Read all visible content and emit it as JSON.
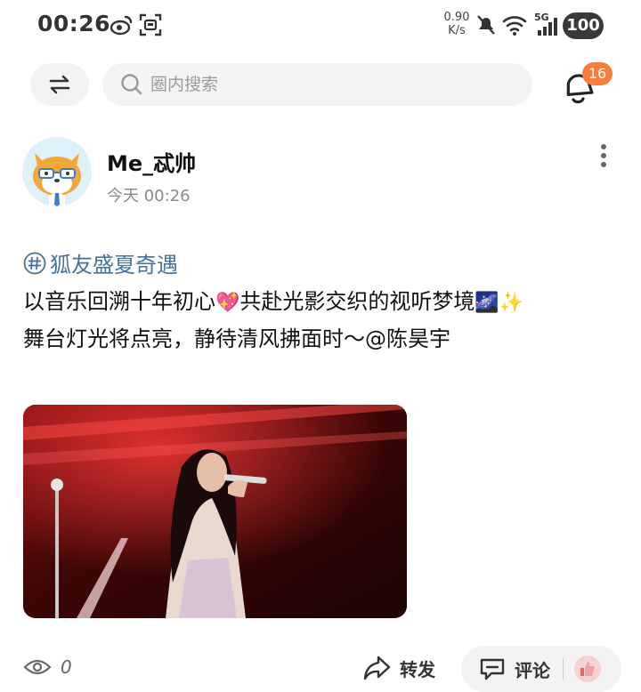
{
  "status_bar": {
    "time": "00:26",
    "net_speed_value": "0.90",
    "net_speed_unit": "K/s",
    "signal_label": "5G",
    "battery": "100",
    "icons": [
      "weibo-icon",
      "screenshot-icon",
      "mute-icon",
      "wifi-icon",
      "signal-icon"
    ]
  },
  "top_bar": {
    "search_placeholder": "圈内搜索",
    "notification_count": "16"
  },
  "post": {
    "author": "Me_忒帅",
    "time": "今天 00:26",
    "topic": "狐友盛夏奇遇",
    "line1_a": "以音乐回溯十年初心",
    "emoji_heart": "💖",
    "line1_b": "共赴光影交织的视听梦境",
    "emoji_galaxy": "🌌",
    "emoji_sparkles": "✨",
    "line2": "舞台灯光将点亮，静待清风拂面时～@陈昊宇"
  },
  "actions": {
    "views": "0",
    "repost": "转发",
    "comment": "评论"
  },
  "colors": {
    "topic": "#46729c",
    "badge": "#fa7d3c",
    "search_bg": "#f3f3f3"
  }
}
